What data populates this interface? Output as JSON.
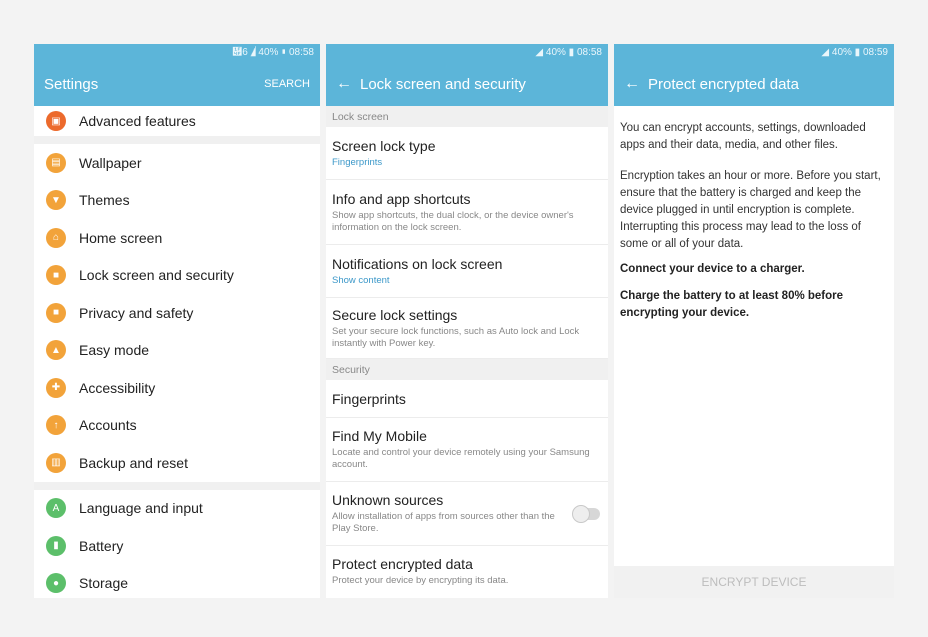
{
  "settings": {
    "status": "὏6 ◢ 40% ▮ 08:58",
    "title": "Settings",
    "search_label": "SEARCH",
    "items": [
      {
        "label": "Advanced features",
        "icon": "advanced-features-icon",
        "glyph": "▣"
      },
      {
        "label": "Wallpaper",
        "icon": "wallpaper-icon",
        "glyph": "▤"
      },
      {
        "label": "Themes",
        "icon": "themes-icon",
        "glyph": "▼"
      },
      {
        "label": "Home screen",
        "icon": "home-icon",
        "glyph": "⌂"
      },
      {
        "label": "Lock screen and security",
        "icon": "lock-icon",
        "glyph": "■"
      },
      {
        "label": "Privacy and safety",
        "icon": "privacy-icon",
        "glyph": "■"
      },
      {
        "label": "Easy mode",
        "icon": "easy-mode-icon",
        "glyph": "▲"
      },
      {
        "label": "Accessibility",
        "icon": "accessibility-icon",
        "glyph": "✚"
      },
      {
        "label": "Accounts",
        "icon": "key-icon",
        "glyph": "↑"
      },
      {
        "label": "Backup and reset",
        "icon": "backup-icon",
        "glyph": "▥"
      },
      {
        "label": "Language and input",
        "icon": "language-icon",
        "glyph": "A"
      },
      {
        "label": "Battery",
        "icon": "battery-icon",
        "glyph": "▮"
      },
      {
        "label": "Storage",
        "icon": "storage-icon",
        "glyph": "●"
      }
    ]
  },
  "lockscreen": {
    "status": "◢ 40% ▮ 08:58",
    "title": "Lock screen and security",
    "sections": {
      "lock": "Lock screen",
      "security": "Security"
    },
    "rows": [
      {
        "title": "Screen lock type",
        "sub": "Fingerprints"
      },
      {
        "title": "Info and app shortcuts",
        "sub": "Show app shortcuts, the dual clock, or the device owner's information on the lock screen."
      },
      {
        "title": "Notifications on lock screen",
        "sub": "Show content"
      },
      {
        "title": "Secure lock settings",
        "sub": "Set your secure lock functions, such as Auto lock and Lock instantly with Power key."
      },
      {
        "title": "Fingerprints",
        "sub": ""
      },
      {
        "title": "Find My Mobile",
        "sub": "Locate and control your device remotely using your Samsung account."
      },
      {
        "title": "Unknown sources",
        "sub": "Allow installation of apps from sources other than the Play Store."
      },
      {
        "title": "Protect encrypted data",
        "sub": "Protect your device by encrypting its data."
      }
    ]
  },
  "encrypt": {
    "status": "◢ 40% ▮ 08:59",
    "title": "Protect encrypted data",
    "para1": "You can encrypt accounts, settings, downloaded apps and their data, media, and other files.",
    "para2": "Encryption takes an hour or more. Before you start, ensure that the battery is charged and keep the device plugged in until encryption is complete. Interrupting this process may lead to the loss of some or all of your data.",
    "bold1": "Connect your device to a charger.",
    "bold2": "Charge the battery to at least 80% before encrypting your device.",
    "button": "ENCRYPT DEVICE"
  },
  "colors": {
    "accent": "#5cb5d9",
    "icon_orange": "#f2a33a",
    "icon_green": "#5cbf6a"
  }
}
